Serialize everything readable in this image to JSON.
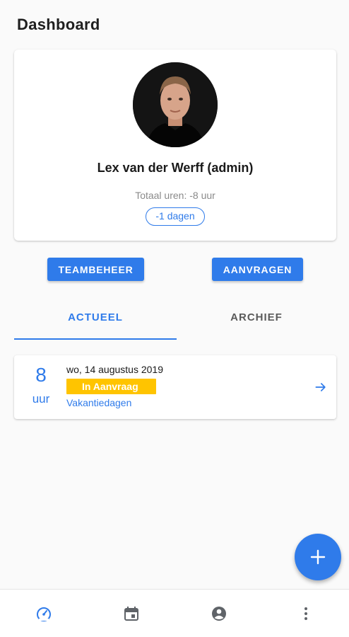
{
  "header": {
    "title": "Dashboard"
  },
  "profile": {
    "name": "Lex van der Werff (admin)",
    "total_hours": "Totaal uren: -8 uur",
    "days_balance": "-1 dagen"
  },
  "actions": {
    "team_button": "TEAMBEHEER",
    "requests_button": "AANVRAGEN"
  },
  "tabs": [
    {
      "label": "ACTUEEL",
      "active": true
    },
    {
      "label": "ARCHIEF",
      "active": false
    }
  ],
  "entries": [
    {
      "hours": "8",
      "unit": "uur",
      "date": "wo, 14 augustus 2019",
      "status": "In Aanvraag",
      "type": "Vakantiedagen"
    }
  ],
  "bottom_nav": [
    {
      "icon": "dashboard-gauge-icon",
      "active": true
    },
    {
      "icon": "calendar-icon",
      "active": false
    },
    {
      "icon": "account-icon",
      "active": false
    },
    {
      "icon": "more-vertical-icon",
      "active": false
    }
  ],
  "colors": {
    "primary": "#2f7bea",
    "status_pending": "#ffc400",
    "icon_inactive": "#5f6368"
  }
}
